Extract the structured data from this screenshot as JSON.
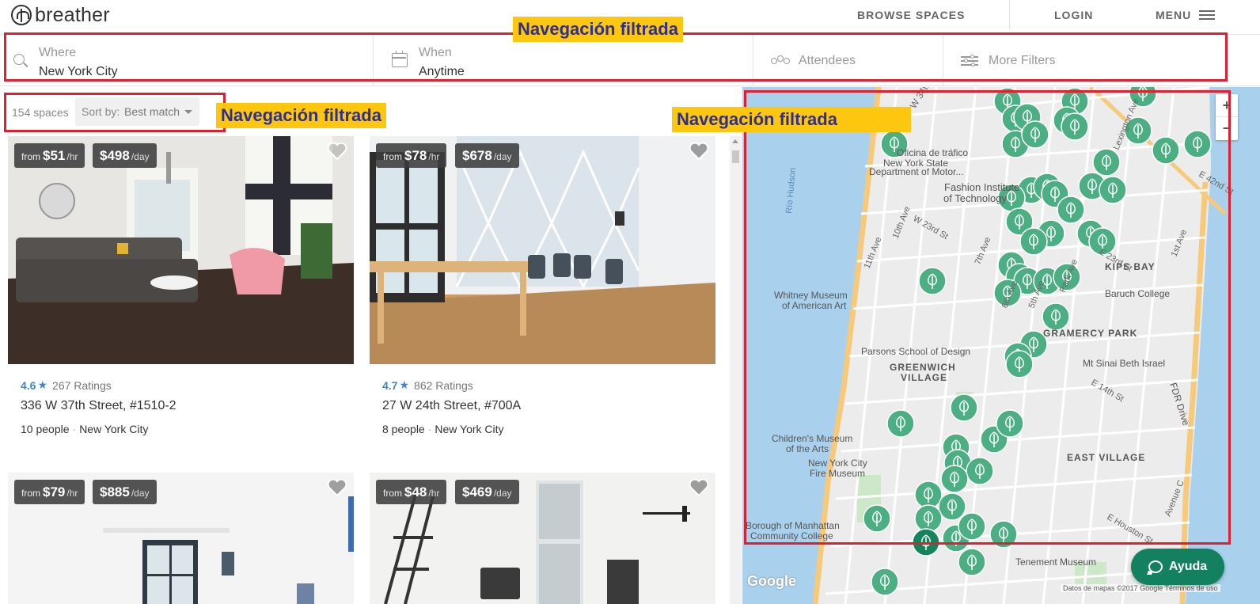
{
  "header": {
    "logo_text": "breather",
    "nav": {
      "browse": "BROWSE SPACES",
      "login": "LOGIN",
      "menu": "MENU"
    }
  },
  "search": {
    "where_label": "Where",
    "where_value": "New York City",
    "when_label": "When",
    "when_value": "Anytime",
    "attendees_label": "Attendees",
    "more_filters_label": "More Filters"
  },
  "results": {
    "count": "154 spaces",
    "sort_label": "Sort by:",
    "sort_value": "Best match"
  },
  "cards": [
    {
      "from": "from",
      "hourly": "$51",
      "hourly_unit": "/hr",
      "daily": "$498",
      "daily_unit": "/day",
      "rating": "4.6",
      "ratings_count": "267 Ratings",
      "address": "336 W 37th Street, #1510-2",
      "people": "10 people",
      "city": "New York City"
    },
    {
      "from": "from",
      "hourly": "$78",
      "hourly_unit": "/hr",
      "daily": "$678",
      "daily_unit": "/day",
      "rating": "4.7",
      "ratings_count": "862 Ratings",
      "address": "27 W 24th Street, #700A",
      "people": "8 people",
      "city": "New York City"
    },
    {
      "from": "from",
      "hourly": "$79",
      "hourly_unit": "/hr",
      "daily": "$885",
      "daily_unit": "/day"
    },
    {
      "from": "from",
      "hourly": "$48",
      "hourly_unit": "/hr",
      "daily": "$469",
      "daily_unit": "/day"
    }
  ],
  "map": {
    "zoom_in": "+",
    "zoom_out": "−",
    "google": "Google",
    "credit": "Datos de mapas ©2017 Google    Términos de uso",
    "labels": [
      "W 34th St",
      "Fashion Institute",
      "of Technology",
      "Oficina de tráfico",
      "New York State",
      "Department of Motor...",
      "Whitney Museum",
      "of American Art",
      "Parsons School of Design",
      "GREENWICH",
      "VILLAGE",
      "Children's Museum",
      "of the Arts",
      "New York City",
      "Fire Museum",
      "Borough of Manhattan",
      "Community College",
      "KIPS BAY",
      "Baruch College",
      "GRAMERCY PARK",
      "Mt Sinai Beth Israel",
      "EAST VILLAGE",
      "Tenement Museum",
      "FDR Drive",
      "11th Ave",
      "10th Ave",
      "7th Ave",
      "6th Ave",
      "5th Ave",
      "Park Ave",
      "Lexington Ave",
      "1st Ave",
      "E 42nd St",
      "E 14th St",
      "E Houston St",
      "Avenue C",
      "Río Hudson",
      "E 23rd St",
      "W 23rd St"
    ]
  },
  "help_button": "Ayuda",
  "annotations": [
    "Navegación filtrada",
    "Navegación filtrada",
    "Navegación filtrada"
  ],
  "colors": {
    "pin": "#4cae83",
    "pin_dark": "#15845d",
    "rating": "#3f86c9",
    "annotation_bg": "#fec70f",
    "annotation_text": "#2e2f8f",
    "annotation_box": "#e0202e",
    "help_btn": "#13815f"
  }
}
